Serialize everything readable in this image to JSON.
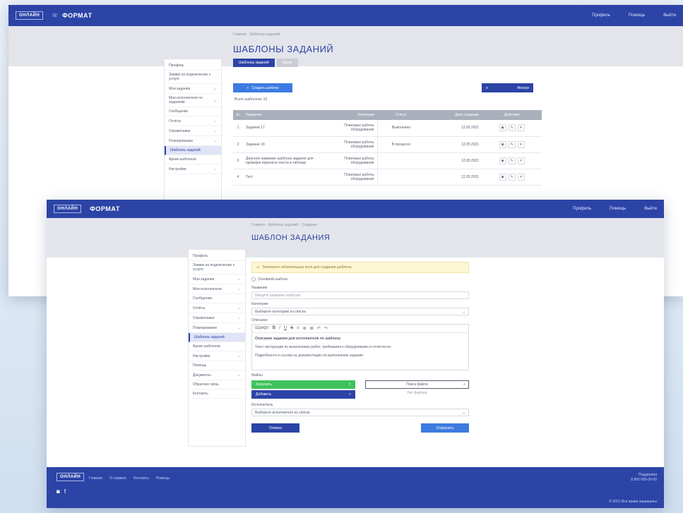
{
  "header": {
    "logo": "ОНЛАЙН",
    "brand": "ФОРМАТ",
    "brand_sub": "",
    "nav": [
      "Профиль",
      "Помощь",
      "Выйти"
    ]
  },
  "back": {
    "breadcrumb": "Главная · Шаблоны заданий",
    "title": "ШАБЛОНЫ ЗАДАНИЙ",
    "tabs": [
      "Шаблоны заданий",
      "Архив"
    ],
    "sidebar": [
      {
        "label": "Профиль",
        "active": false
      },
      {
        "label": "Заявки на подключение к услуге",
        "active": false
      },
      {
        "label": "Мои задания",
        "active": false
      },
      {
        "label": "Мои исполнители по заданиям",
        "active": false
      },
      {
        "label": "Сообщения",
        "active": false
      },
      {
        "label": "Отчёты",
        "active": false
      },
      {
        "label": "Справочники",
        "active": false
      },
      {
        "label": "Планирование",
        "active": false
      },
      {
        "label": "Шаблоны заданий",
        "active": true
      },
      {
        "label": "Архив шаблонов",
        "active": false
      },
      {
        "label": "Настройки",
        "active": false
      }
    ],
    "create_button": "Создать шаблон",
    "filter_button": "Фильтр",
    "count_label": "Всего шаблонов: 10",
    "columns": [
      "№",
      "Название",
      "Категория",
      "Статус",
      "Дата создания",
      "Действия"
    ],
    "rows": [
      {
        "num": "1",
        "name": "Задание 17",
        "category": "Плановые работы оборудования",
        "status": "Выполнено",
        "date": "12.05.2021"
      },
      {
        "num": "2",
        "name": "Задание 18",
        "category": "Плановые работы оборудования",
        "status": "В процессе",
        "date": "12.05.2021"
      },
      {
        "num": "3",
        "name": "Длинное название шаблона задания для проверки переноса текста в таблице",
        "category": "Плановые работы оборудования",
        "status": "",
        "date": "12.05.2021"
      },
      {
        "num": "4",
        "name": "Тест",
        "category": "Плановые работы оборудования",
        "status": "",
        "date": "12.05.2021"
      }
    ]
  },
  "front": {
    "breadcrumb": "Главная · Шаблоны заданий · Создание",
    "title": "ШАБЛОН ЗАДАНИЯ",
    "sidebar": [
      {
        "label": "Профиль",
        "active": false
      },
      {
        "label": "Заявки на подключение к услуге",
        "active": false
      },
      {
        "label": "Мои задания",
        "active": false
      },
      {
        "label": "Мои исполнители",
        "active": false
      },
      {
        "label": "Сообщения",
        "active": false
      },
      {
        "label": "Отчёты",
        "active": false
      },
      {
        "label": "Справочники",
        "active": false
      },
      {
        "label": "Планирование",
        "active": false
      },
      {
        "label": "Шаблоны заданий",
        "active": true
      },
      {
        "label": "Архив шаблонов",
        "active": false
      },
      {
        "label": "Настройки",
        "active": false
      },
      {
        "label": "Помощь",
        "active": false
      },
      {
        "label": "Документы",
        "active": false
      },
      {
        "label": "Обратная связь",
        "active": false
      },
      {
        "label": "Контакты",
        "active": false
      }
    ],
    "alert": "Заполните обязательные поля для создания шаблона",
    "radio_label": "Основной шаблон",
    "name_label": "Название",
    "name_placeholder": "Введите название шаблона",
    "category_label": "Категория",
    "category_value": "Выберите категорию из списка",
    "desc_label": "Описание",
    "editor_tools": [
      "Шрифт",
      "B",
      "I",
      "U",
      "S",
      "≡",
      "≣",
      "⊞",
      "↶",
      "↷"
    ],
    "editor_lines": [
      "Описание задания для исполнителя по шаблону",
      "Текст инструкции по выполнению работ, требования к оборудованию и отчётности",
      "Подробности и ссылки на документацию по выполнению задания"
    ],
    "files_label": "Файлы",
    "upload_button": "Загрузить",
    "add_button": "Добавить",
    "search_placeholder": "Поиск файла",
    "no_files": "Нет файлов",
    "exec_label": "Исполнитель",
    "exec_value": "Выберите исполнителя из списка",
    "cancel_button": "Отмена",
    "save_button": "Сохранить"
  },
  "footer": {
    "logo": "ОНЛАЙН",
    "nav": [
      "Главная",
      "О сервисе",
      "Контакты",
      "Помощь"
    ],
    "right_top": [
      "Поддержка",
      "8 800 000-00-00"
    ],
    "right_bottom": "© 2021 Все права защищены"
  }
}
